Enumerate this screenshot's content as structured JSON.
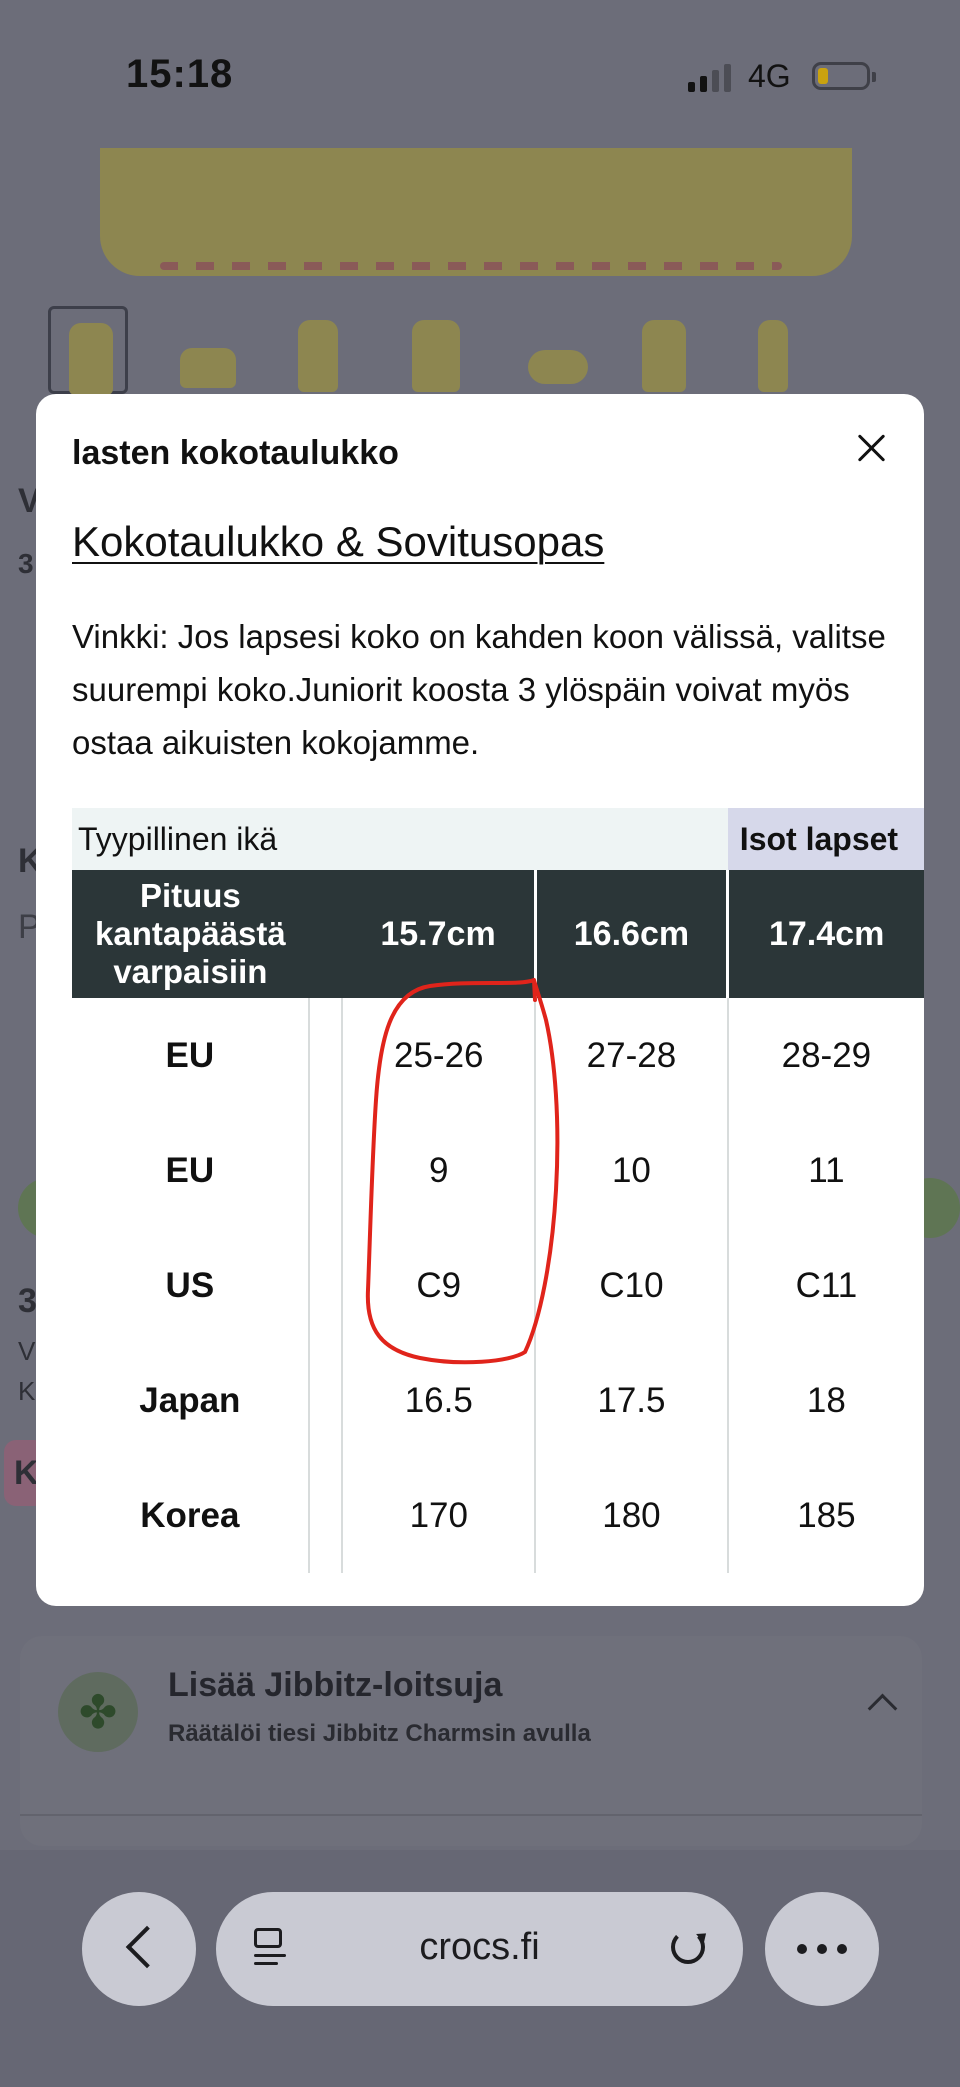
{
  "status_bar": {
    "time": "15:18",
    "network": "4G"
  },
  "modal": {
    "title": "lasten kokotaulukko",
    "guide_link": "Kokotaulukko & Sovitusopas",
    "tip": "Vinkki: Jos lapsesi koko on kahden koon välissä, valitse suurempi koko.Juniorit koosta 3 ylöspäin voivat myös ostaa aikuisten kokojamme.",
    "table": {
      "age_label": "Tyypillinen ikä",
      "age_group": "Isot lapset",
      "header_first": "Pituus kantapäästä varpaisiin",
      "header_cols": [
        "15.7cm",
        "16.6cm",
        "17.4cm"
      ],
      "rows": [
        {
          "label": "EU",
          "values": [
            "25-26",
            "27-28",
            "28-29"
          ]
        },
        {
          "label": "EU",
          "values": [
            "9",
            "10",
            "11"
          ]
        },
        {
          "label": "US",
          "values": [
            "C9",
            "C10",
            "C11"
          ]
        },
        {
          "label": "Japan",
          "values": [
            "16.5",
            "17.5",
            "18"
          ]
        },
        {
          "label": "Korea",
          "values": [
            "170",
            "180",
            "185"
          ]
        }
      ]
    }
  },
  "background": {
    "jibbitz_title": "Lisää Jibbitz-loitsuja",
    "jibbitz_subtitle": "Räätälöi tiesi Jibbitz Charmsin avulla",
    "letters": [
      "V",
      "3",
      "K",
      "P",
      "3",
      "V",
      "K",
      "K"
    ]
  },
  "browser": {
    "url": "crocs.fi"
  },
  "colors": {
    "overlay": "#6c6d79",
    "table_header": "#2b3638",
    "age_group_bg": "#d6d8ea",
    "annotation_circle": "#e0241b"
  }
}
